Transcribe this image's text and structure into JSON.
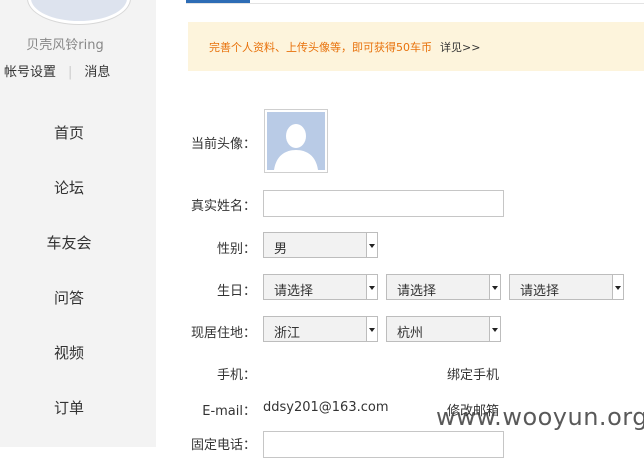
{
  "sidebar": {
    "username": "贝壳风铃ring",
    "account_settings": "帐号设置",
    "messages": "消息",
    "nav": [
      "首页",
      "论坛",
      "车友会",
      "问答",
      "视频",
      "订单"
    ]
  },
  "notice": {
    "text": "完善个人资料、上传头像等，即可获得50车币",
    "link": "详见>>"
  },
  "form": {
    "avatar_label": "当前头像：",
    "realname_label": "真实姓名：",
    "realname_value": "",
    "gender_label": "性别：",
    "gender_value": "男",
    "birthday_label": "生日：",
    "birthday_year": "请选择",
    "birthday_month": "请选择",
    "birthday_day": "请选择",
    "residence_label": "现居住地：",
    "province": "浙江",
    "city": "杭州",
    "phone_label": "手机：",
    "bind_phone": "绑定手机",
    "email_label": "E-mail：",
    "email_value": "ddsy201@163.com",
    "change_email": "修改邮箱",
    "landline_label": "固定电话："
  },
  "watermark": "www.wooyun.org",
  "colors": {
    "accent": "#2d6cb5",
    "notice_bg": "#fdf4dc",
    "notice_text": "#e8720c",
    "sidebar_bg": "#f3f3f3"
  }
}
